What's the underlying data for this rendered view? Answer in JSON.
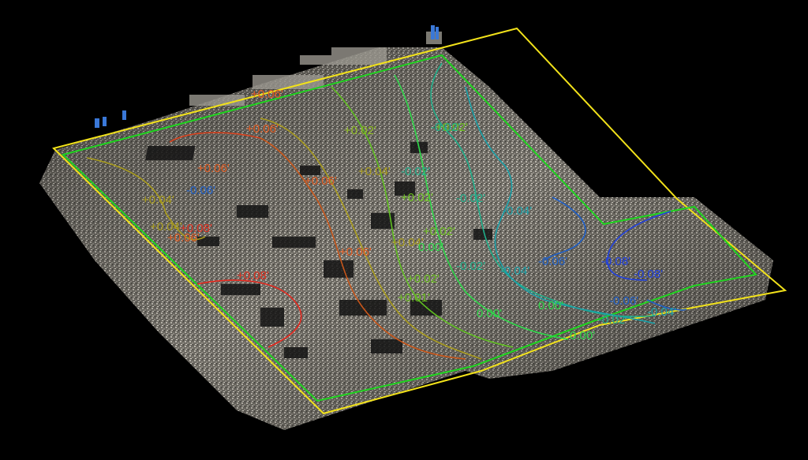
{
  "colors": {
    "background": "#000000",
    "boundary_outer": "#f2e21a",
    "boundary_inner": "#1fd41f"
  },
  "contours": [
    {
      "id": "p08-left",
      "color": "#e8281e"
    },
    {
      "id": "p08-top",
      "color": "#d8401c"
    },
    {
      "id": "p06",
      "color": "#c8561a"
    },
    {
      "id": "p04",
      "color": "#a89b1c"
    },
    {
      "id": "p02",
      "color": "#5fbf20"
    },
    {
      "id": "z00",
      "color": "#2ed84a"
    },
    {
      "id": "m02",
      "color": "#1fae8a"
    },
    {
      "id": "m04",
      "color": "#1aa0a8"
    },
    {
      "id": "m06",
      "color": "#1e5fc8"
    },
    {
      "id": "m08",
      "color": "#2040e0"
    }
  ],
  "labels": [
    {
      "text": "+0.06'",
      "color": "#e05a20"
    },
    {
      "text": "+0.06'",
      "color": "#e05a20"
    },
    {
      "text": "+0.06'",
      "color": "#e05a20"
    },
    {
      "text": "+0.08'",
      "color": "#e03020"
    },
    {
      "text": "+0.06'",
      "color": "#e05a20"
    },
    {
      "text": "+0.08'",
      "color": "#e03020"
    },
    {
      "text": "+0.04'",
      "color": "#a89b1c"
    },
    {
      "text": "+0.02'",
      "color": "#8cba20"
    },
    {
      "text": "+0.02'",
      "color": "#6cc020"
    },
    {
      "text": "+0.04'",
      "color": "#a89b1c"
    },
    {
      "text": "+0.04'",
      "color": "#a89b1c"
    },
    {
      "text": "+0.02'",
      "color": "#6cc020"
    },
    {
      "text": "+0.01'",
      "color": "#6cc020"
    },
    {
      "text": "+0.04'",
      "color": "#a89b1c"
    },
    {
      "text": "+0.06'",
      "color": "#e05a20"
    },
    {
      "text": "+0.06'",
      "color": "#e05a20"
    },
    {
      "text": "+0.02'",
      "color": "#6cc020"
    },
    {
      "text": "0.00'",
      "color": "#2ed84a"
    },
    {
      "text": "0.00'",
      "color": "#2ed84a"
    },
    {
      "text": "-0.02'",
      "color": "#1fae8a"
    },
    {
      "text": "-0.02'",
      "color": "#1fae8a"
    },
    {
      "text": "-0.04'",
      "color": "#1aa0a8"
    },
    {
      "text": "-0.02'",
      "color": "#1fae8a"
    },
    {
      "text": "-0.04'",
      "color": "#1aa0a8"
    },
    {
      "text": "0.00'",
      "color": "#2ed84a"
    },
    {
      "text": "-0.02'",
      "color": "#1fae8a"
    },
    {
      "text": "0.00'",
      "color": "#2ed84a"
    },
    {
      "text": "-0.06'",
      "color": "#1e5fc8"
    },
    {
      "text": "-0.08'",
      "color": "#2040e0"
    },
    {
      "text": "-0.08'",
      "color": "#2040e0"
    },
    {
      "text": "-0.06'",
      "color": "#1e5fc8"
    },
    {
      "text": "-0.04'",
      "color": "#1aa0a8"
    },
    {
      "text": "-0.06'",
      "color": "#1e5fc8"
    },
    {
      "text": "+0.02'",
      "color": "#6cc020"
    },
    {
      "text": "-0.02'",
      "color": "#1fae8a"
    }
  ]
}
